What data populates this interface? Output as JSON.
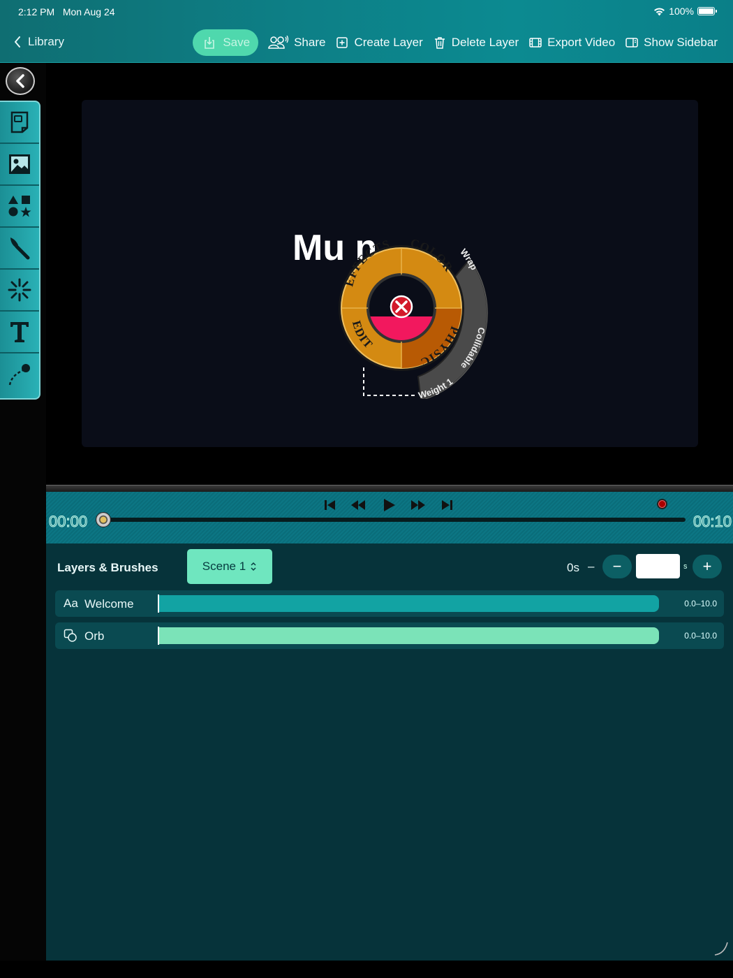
{
  "status": {
    "time": "2:12 PM",
    "date": "Mon Aug 24",
    "battery": "100%"
  },
  "nav": {
    "back_label": "Library"
  },
  "toolbar": {
    "save": "Save",
    "share": "Share",
    "create_layer": "Create Layer",
    "delete_layer": "Delete Layer",
    "export_video": "Export Video",
    "show_sidebar": "Show Sidebar"
  },
  "tools": [
    {
      "name": "page-icon"
    },
    {
      "name": "image-icon"
    },
    {
      "name": "shapes-icon"
    },
    {
      "name": "brush-icon"
    },
    {
      "name": "sparkle-icon"
    },
    {
      "name": "text-icon"
    },
    {
      "name": "path-icon"
    }
  ],
  "canvas": {
    "title_text": "Mu          n",
    "radial_menu": {
      "inner": [
        "EFFECTS",
        "COLOR",
        "PHYSICS",
        "EDIT"
      ],
      "outer": [
        "Wrap",
        "Collidable",
        "Weight 1"
      ]
    }
  },
  "transport": {
    "time_start": "00:00",
    "time_end": "00:10",
    "progress": 0
  },
  "layers": {
    "title": "Layers & Brushes",
    "scene": "Scene 1",
    "duration_label": "0s",
    "duration_dash": "–",
    "duration_value": "",
    "duration_unit": "s",
    "minus": "−",
    "plus": "+",
    "items": [
      {
        "icon": "Aa",
        "name": "Welcome",
        "range": "0.0–10.0",
        "color": "#12a3a3"
      },
      {
        "icon": "",
        "name": "Orb",
        "range": "0.0–10.0",
        "color": "#7be3b8"
      }
    ]
  },
  "colors": {
    "accent": "#4fd8ad",
    "topbar": "#0d7f86",
    "panel": "#06333a"
  }
}
